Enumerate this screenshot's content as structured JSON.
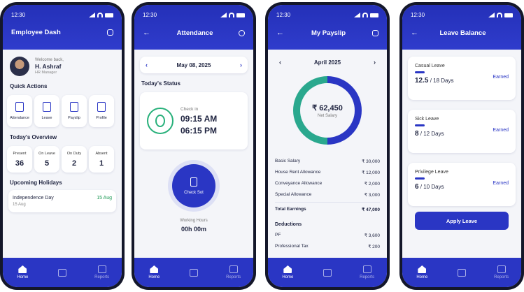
{
  "colors": {
    "primary": "#2a36c4",
    "success": "#27b07a",
    "teal": "#2aa88e",
    "background": "#f4f5f9"
  },
  "status_time": "12:30",
  "nav": {
    "home": "Home",
    "reports": "Reports"
  },
  "dashboard": {
    "title": "Employee Dash",
    "welcome": "Welcome back,",
    "name": "H. Ashraf",
    "role": "HR Manager",
    "quick_actions_title": "Quick Actions",
    "quick_actions": [
      "Attendance",
      "Leave",
      "Payslip",
      "Profile"
    ],
    "overview_title": "Today's Overview",
    "overview": [
      {
        "label": "Present",
        "value": "36"
      },
      {
        "label": "On Leave",
        "value": "5"
      },
      {
        "label": "On Duty",
        "value": "2"
      },
      {
        "label": "Absent",
        "value": "1"
      }
    ],
    "holidays_title": "Upcoming Holidays",
    "holiday": {
      "name": "Independence Day",
      "date": "15 Aug",
      "year": "15 Aug"
    }
  },
  "attendance": {
    "title": "Attendance",
    "date": "May 08, 2025",
    "status_title": "Today's Status",
    "check_in_label": "Check in",
    "check_in_time": "09:15 AM",
    "check_out_time": "06:15 PM",
    "check_button": "Check Sot",
    "working_hours_label": "Working Hours",
    "working_hours": "00h 00m"
  },
  "payslip": {
    "title": "My Payslip",
    "month": "April 2025",
    "net_amount": "₹ 62,450",
    "net_label": "Net Salary",
    "earnings": [
      {
        "label": "Basic Salary",
        "value": "₹ 30,000"
      },
      {
        "label": "House Rent Allowance",
        "value": "₹ 12,000"
      },
      {
        "label": "Conveyance Allowance",
        "value": "₹ 2,000"
      },
      {
        "label": "Special Allowance",
        "value": "₹ 3,000"
      }
    ],
    "total_label": "Total Earnings",
    "total_value": "₹ 47,000",
    "deductions_title": "Deductions",
    "deductions": [
      {
        "label": "PF",
        "value": "₹ 3,600"
      },
      {
        "label": "Professional Tax",
        "value": "₹ 200"
      }
    ]
  },
  "leave": {
    "title": "Leave Balance",
    "items": [
      {
        "name": "Casual Leave",
        "used": "12.5",
        "total": "18 Days",
        "status": "Earned"
      },
      {
        "name": "Sick Leave",
        "used": "8",
        "total": "12 Days",
        "status": "Earned"
      },
      {
        "name": "Privilege Leave",
        "used": "6",
        "total": "10 Days",
        "status": "Earned"
      }
    ],
    "apply_button": "Apply Leave"
  }
}
